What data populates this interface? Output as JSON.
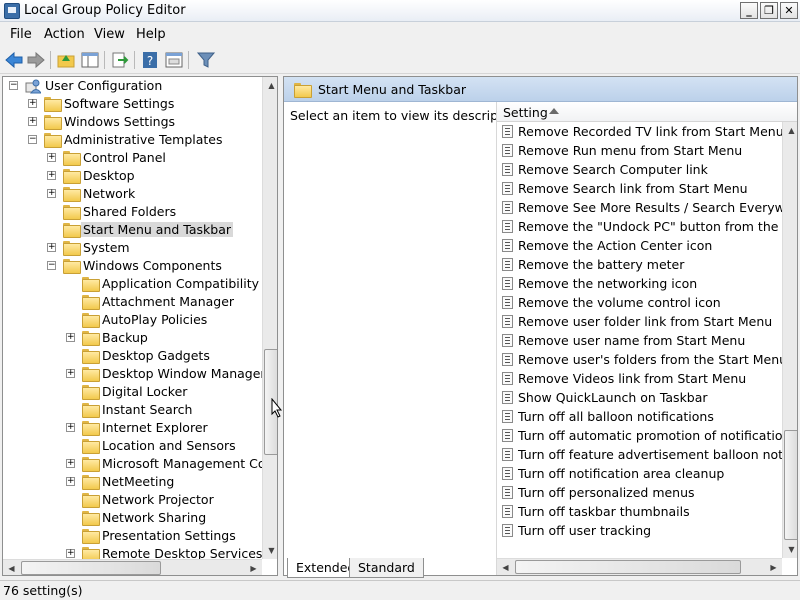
{
  "window": {
    "title": "Local Group Policy Editor",
    "controls": [
      "_",
      "❐",
      "✕"
    ]
  },
  "menu": [
    "File",
    "Action",
    "View",
    "Help"
  ],
  "toolbar": {
    "buttons": [
      "back-icon",
      "forward-icon",
      "up-folder-icon",
      "show-hide-tree-icon",
      "export-list-icon",
      "help-icon",
      "properties-icon",
      "filter-icon"
    ]
  },
  "tree": {
    "items": [
      {
        "label": "User Configuration",
        "level": 0,
        "expander": "−",
        "icon": "user-icon"
      },
      {
        "label": "Software Settings",
        "level": 1,
        "expander": "+"
      },
      {
        "label": "Windows Settings",
        "level": 1,
        "expander": "+"
      },
      {
        "label": "Administrative Templates",
        "level": 1,
        "expander": "−"
      },
      {
        "label": "Control Panel",
        "level": 2,
        "expander": "+"
      },
      {
        "label": "Desktop",
        "level": 2,
        "expander": "+"
      },
      {
        "label": "Network",
        "level": 2,
        "expander": "+"
      },
      {
        "label": "Shared Folders",
        "level": 2,
        "expander": ""
      },
      {
        "label": "Start Menu and Taskbar",
        "level": 2,
        "expander": "",
        "selected": true
      },
      {
        "label": "System",
        "level": 2,
        "expander": "+"
      },
      {
        "label": "Windows Components",
        "level": 2,
        "expander": "−"
      },
      {
        "label": "Application Compatibility",
        "level": 3,
        "expander": ""
      },
      {
        "label": "Attachment Manager",
        "level": 3,
        "expander": ""
      },
      {
        "label": "AutoPlay Policies",
        "level": 3,
        "expander": ""
      },
      {
        "label": "Backup",
        "level": 3,
        "expander": "+"
      },
      {
        "label": "Desktop Gadgets",
        "level": 3,
        "expander": ""
      },
      {
        "label": "Desktop Window Manager",
        "level": 3,
        "expander": "+"
      },
      {
        "label": "Digital Locker",
        "level": 3,
        "expander": ""
      },
      {
        "label": "Instant Search",
        "level": 3,
        "expander": ""
      },
      {
        "label": "Internet Explorer",
        "level": 3,
        "expander": "+"
      },
      {
        "label": "Location and Sensors",
        "level": 3,
        "expander": ""
      },
      {
        "label": "Microsoft Management Conso",
        "level": 3,
        "expander": "+"
      },
      {
        "label": "NetMeeting",
        "level": 3,
        "expander": "+"
      },
      {
        "label": "Network Projector",
        "level": 3,
        "expander": ""
      },
      {
        "label": "Network Sharing",
        "level": 3,
        "expander": ""
      },
      {
        "label": "Presentation Settings",
        "level": 3,
        "expander": ""
      },
      {
        "label": "Remote Desktop Services",
        "level": 3,
        "expander": "+"
      }
    ]
  },
  "right_pane": {
    "header_title": "Start Menu and Taskbar",
    "description": "Select an item to view its description.",
    "column_header": "Setting",
    "settings": [
      "Remove Recorded TV link from Start Menu",
      "Remove Run menu from Start Menu",
      "Remove Search Computer link",
      "Remove Search link from Start Menu",
      "Remove See More Results / Search Everywhere link",
      "Remove the \"Undock PC\" button from the Start Menu",
      "Remove the Action Center icon",
      "Remove the battery meter",
      "Remove the networking icon",
      "Remove the volume control icon",
      "Remove user folder link from Start Menu",
      "Remove user name from Start Menu",
      "Remove user's folders from the Start Menu",
      "Remove Videos link from Start Menu",
      "Show QuickLaunch on Taskbar",
      "Turn off all balloon notifications",
      "Turn off automatic promotion of notification icons",
      "Turn off feature advertisement balloon notifications",
      "Turn off notification area cleanup",
      "Turn off personalized menus",
      "Turn off taskbar thumbnails",
      "Turn off user tracking"
    ]
  },
  "tabs": [
    "Extended",
    "Standard"
  ],
  "status": "76 setting(s)",
  "colors": {
    "header_blue": "#c6d9f0",
    "folder_yellow": "#f2c94c",
    "accent": "#3b6ea8"
  }
}
